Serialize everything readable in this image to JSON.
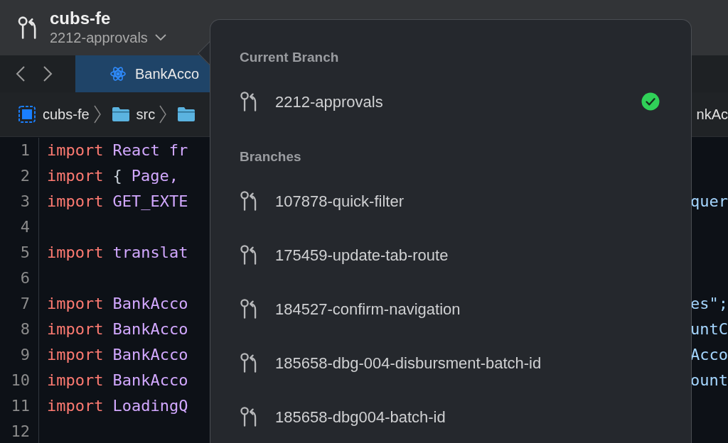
{
  "header": {
    "repo": "cubs-fe",
    "branch": "2212-approvals"
  },
  "tabs": [
    {
      "label": "BankAcco",
      "selected": true
    }
  ],
  "breadcrumb": [
    {
      "kind": "project",
      "label": "cubs-fe"
    },
    {
      "kind": "folder",
      "label": "src"
    },
    {
      "kind": "folder"
    }
  ],
  "breadcrumb_end": "nkAc",
  "code": [
    {
      "number": "1",
      "tokens": [
        {
          "kind": "keyword",
          "text": "import"
        },
        {
          "kind": "name",
          "text": "React"
        },
        {
          "kind": "name",
          "text": "fr"
        }
      ]
    },
    {
      "number": "2",
      "tokens": [
        {
          "kind": "keyword",
          "text": "import"
        },
        {
          "kind": "punct",
          "text": "{"
        },
        {
          "kind": "name",
          "text": "Page,"
        }
      ]
    },
    {
      "number": "3",
      "tokens": [
        {
          "kind": "keyword",
          "text": "import"
        },
        {
          "kind": "name",
          "text": "GET_EXTE"
        }
      ],
      "tail": "quer"
    },
    {
      "number": "4"
    },
    {
      "number": "5",
      "tokens": [
        {
          "kind": "keyword",
          "text": "import"
        },
        {
          "kind": "name",
          "text": "translat"
        }
      ]
    },
    {
      "number": "6"
    },
    {
      "number": "7",
      "tokens": [
        {
          "kind": "keyword",
          "text": "import"
        },
        {
          "kind": "name",
          "text": "BankAcco"
        }
      ],
      "tail": "es\";"
    },
    {
      "number": "8",
      "tokens": [
        {
          "kind": "keyword",
          "text": "import"
        },
        {
          "kind": "name",
          "text": "BankAcco"
        }
      ],
      "tail": "untC"
    },
    {
      "number": "9",
      "tokens": [
        {
          "kind": "keyword",
          "text": "import"
        },
        {
          "kind": "name",
          "text": "BankAcco"
        }
      ],
      "tail": "Acco"
    },
    {
      "number": "10",
      "tokens": [
        {
          "kind": "keyword",
          "text": "import"
        },
        {
          "kind": "name",
          "text": "BankAcco"
        }
      ],
      "tail": "ount"
    },
    {
      "number": "11",
      "tokens": [
        {
          "kind": "keyword",
          "text": "import"
        },
        {
          "kind": "name",
          "text": "LoadingQ"
        }
      ]
    },
    {
      "number": "12"
    }
  ],
  "branch_menu": [
    {
      "heading": "Current Branch",
      "branches": [
        {
          "name": "2212-approvals",
          "selected": true
        }
      ]
    },
    {
      "heading": "Branches",
      "branches": [
        {
          "name": "107878-quick-filter",
          "selected": false
        },
        {
          "name": "175459-update-tab-route",
          "selected": false
        },
        {
          "name": "184527-confirm-navigation",
          "selected": false
        },
        {
          "name": "185658-dbg-004-disbursment-batch-id",
          "selected": false
        },
        {
          "name": "185658-dbg004-batch-id",
          "selected": false
        }
      ]
    }
  ]
}
